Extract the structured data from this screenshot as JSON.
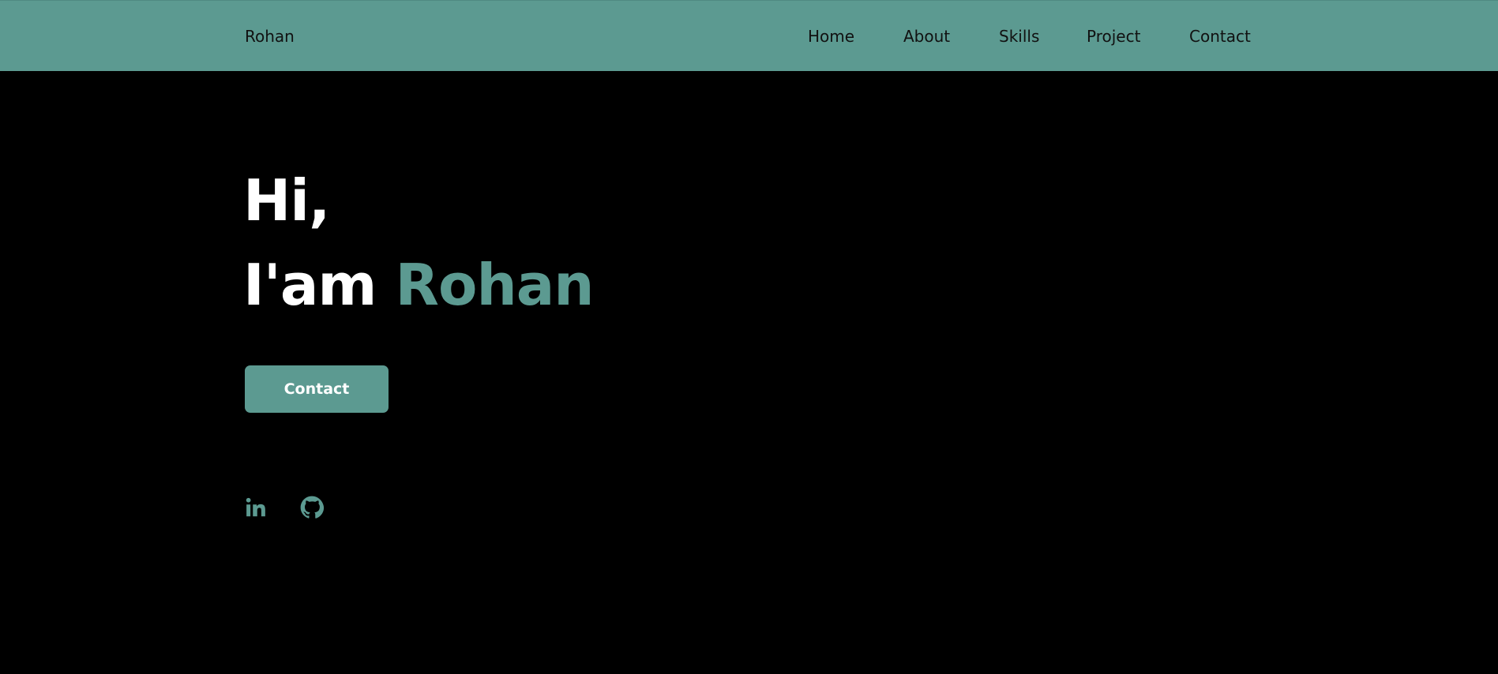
{
  "header": {
    "brand": "Rohan",
    "nav": [
      {
        "label": "Home"
      },
      {
        "label": "About"
      },
      {
        "label": "Skills"
      },
      {
        "label": "Project"
      },
      {
        "label": "Contact"
      }
    ]
  },
  "hero": {
    "greeting": "Hi,",
    "intro": "I'am",
    "name": "Rohan",
    "button_label": "Contact"
  },
  "social": [
    {
      "icon": "linkedin-icon"
    },
    {
      "icon": "github-icon"
    }
  ],
  "colors": {
    "accent": "#5c9a91",
    "background": "#000000",
    "text": "#ffffff",
    "nav_text": "#111111"
  }
}
